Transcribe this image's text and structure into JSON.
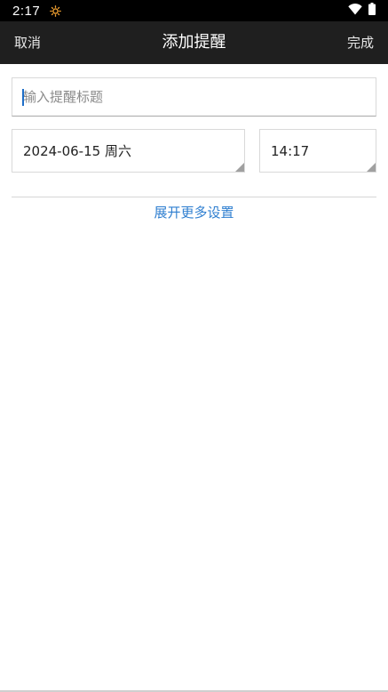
{
  "status_bar": {
    "time": "2:17",
    "icons": [
      "sun-icon",
      "wifi-icon",
      "battery-icon"
    ]
  },
  "app_bar": {
    "cancel_label": "取消",
    "title": "添加提醒",
    "done_label": "完成"
  },
  "form": {
    "title_input": {
      "placeholder": "输入提醒标题",
      "value": ""
    },
    "date_value": "2024-06-15 周六",
    "time_value": "14:17",
    "expand_label": "展开更多设置"
  },
  "colors": {
    "status_bar_bg": "#000000",
    "app_bar_bg": "#1f1f1f",
    "link": "#2f7fd0",
    "sun_icon": "#f0a030"
  }
}
